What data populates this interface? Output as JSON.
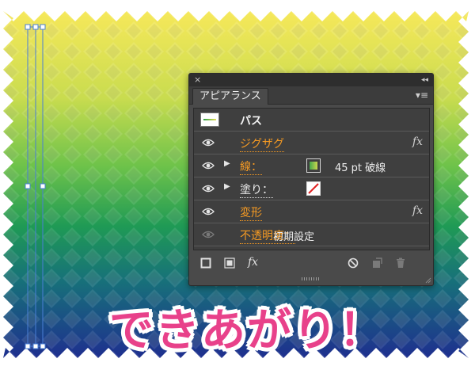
{
  "panel": {
    "tab_label": "アピアランス",
    "close_glyph": "×",
    "collapse_glyph": "◂◂",
    "menu_glyph": "▾≡",
    "rows": {
      "path": {
        "label": "パス"
      },
      "zigzag": {
        "label": "ジグザグ",
        "fx": "fx"
      },
      "stroke": {
        "label": "線：",
        "value": "45 pt 破線"
      },
      "fill": {
        "label": "塗り："
      },
      "transform": {
        "label": "変形",
        "fx": "fx"
      },
      "opacity": {
        "label": "不透明度：",
        "value": "初期設定"
      }
    },
    "footer": {
      "fx": "fx"
    }
  },
  "caption": "できあがり！",
  "colors": {
    "accent_orange": "#f59a23",
    "caption_pink": "#e8418a",
    "gradient_top": "#f6e85a",
    "gradient_mid": "#4cb84a",
    "gradient_bottom": "#1e2f8f",
    "selection_blue": "#4a7fd6"
  },
  "icons": [
    "visibility-eye-icon",
    "expand-triangle-icon",
    "fx-icon",
    "panel-menu-icon",
    "new-stroke-icon",
    "new-fill-icon",
    "clear-appearance-icon",
    "duplicate-item-icon",
    "delete-item-icon"
  ]
}
